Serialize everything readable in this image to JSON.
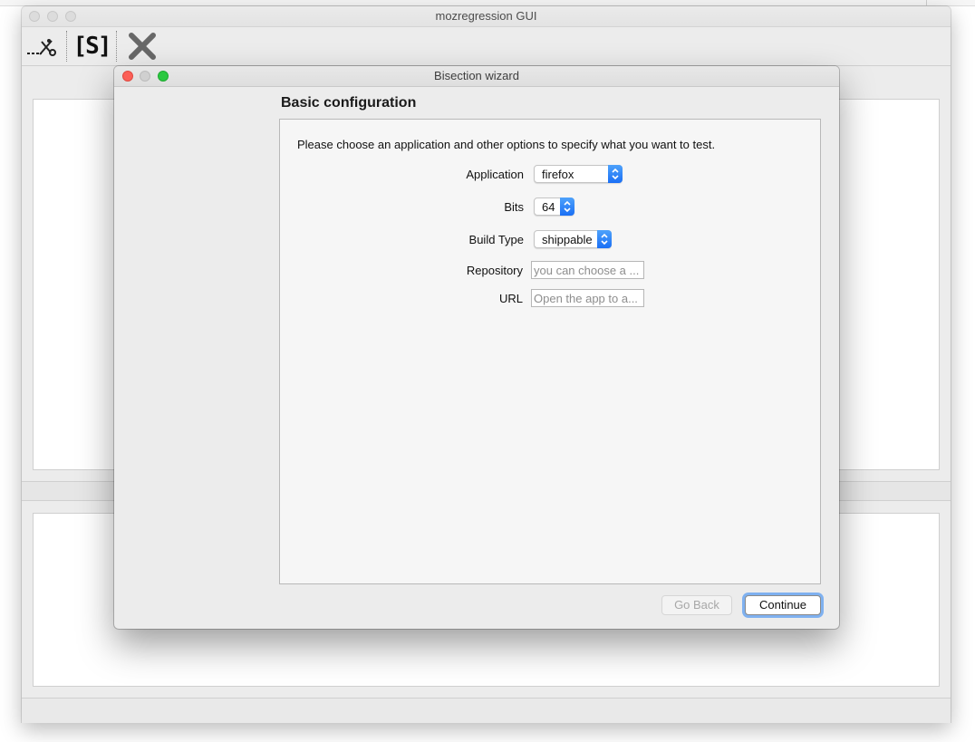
{
  "main_window": {
    "title": "mozregression GUI",
    "toolbar": {
      "bisect_tool": "scissors-icon",
      "single_run_tool": "single-run-icon",
      "stop_tool": "stop-x-icon",
      "single_run_glyph": "[S]"
    }
  },
  "dialog": {
    "title": "Bisection wizard",
    "page_title": "Basic configuration",
    "intro": "Please choose an application and other options to specify what you want to test.",
    "fields": {
      "application": {
        "label": "Application",
        "value": "firefox"
      },
      "bits": {
        "label": "Bits",
        "value": "64"
      },
      "build_type": {
        "label": "Build Type",
        "value": "shippable"
      },
      "repository": {
        "label": "Repository",
        "placeholder": "you can choose a ..."
      },
      "url": {
        "label": "URL",
        "placeholder": "Open the app to a..."
      }
    },
    "buttons": {
      "back": "Go Back",
      "continue": "Continue"
    }
  },
  "colors": {
    "accent": "#1a6ff5",
    "close": "#fc5f57",
    "zoom": "#2bc840",
    "focus_ring": "#7fb1f0"
  }
}
